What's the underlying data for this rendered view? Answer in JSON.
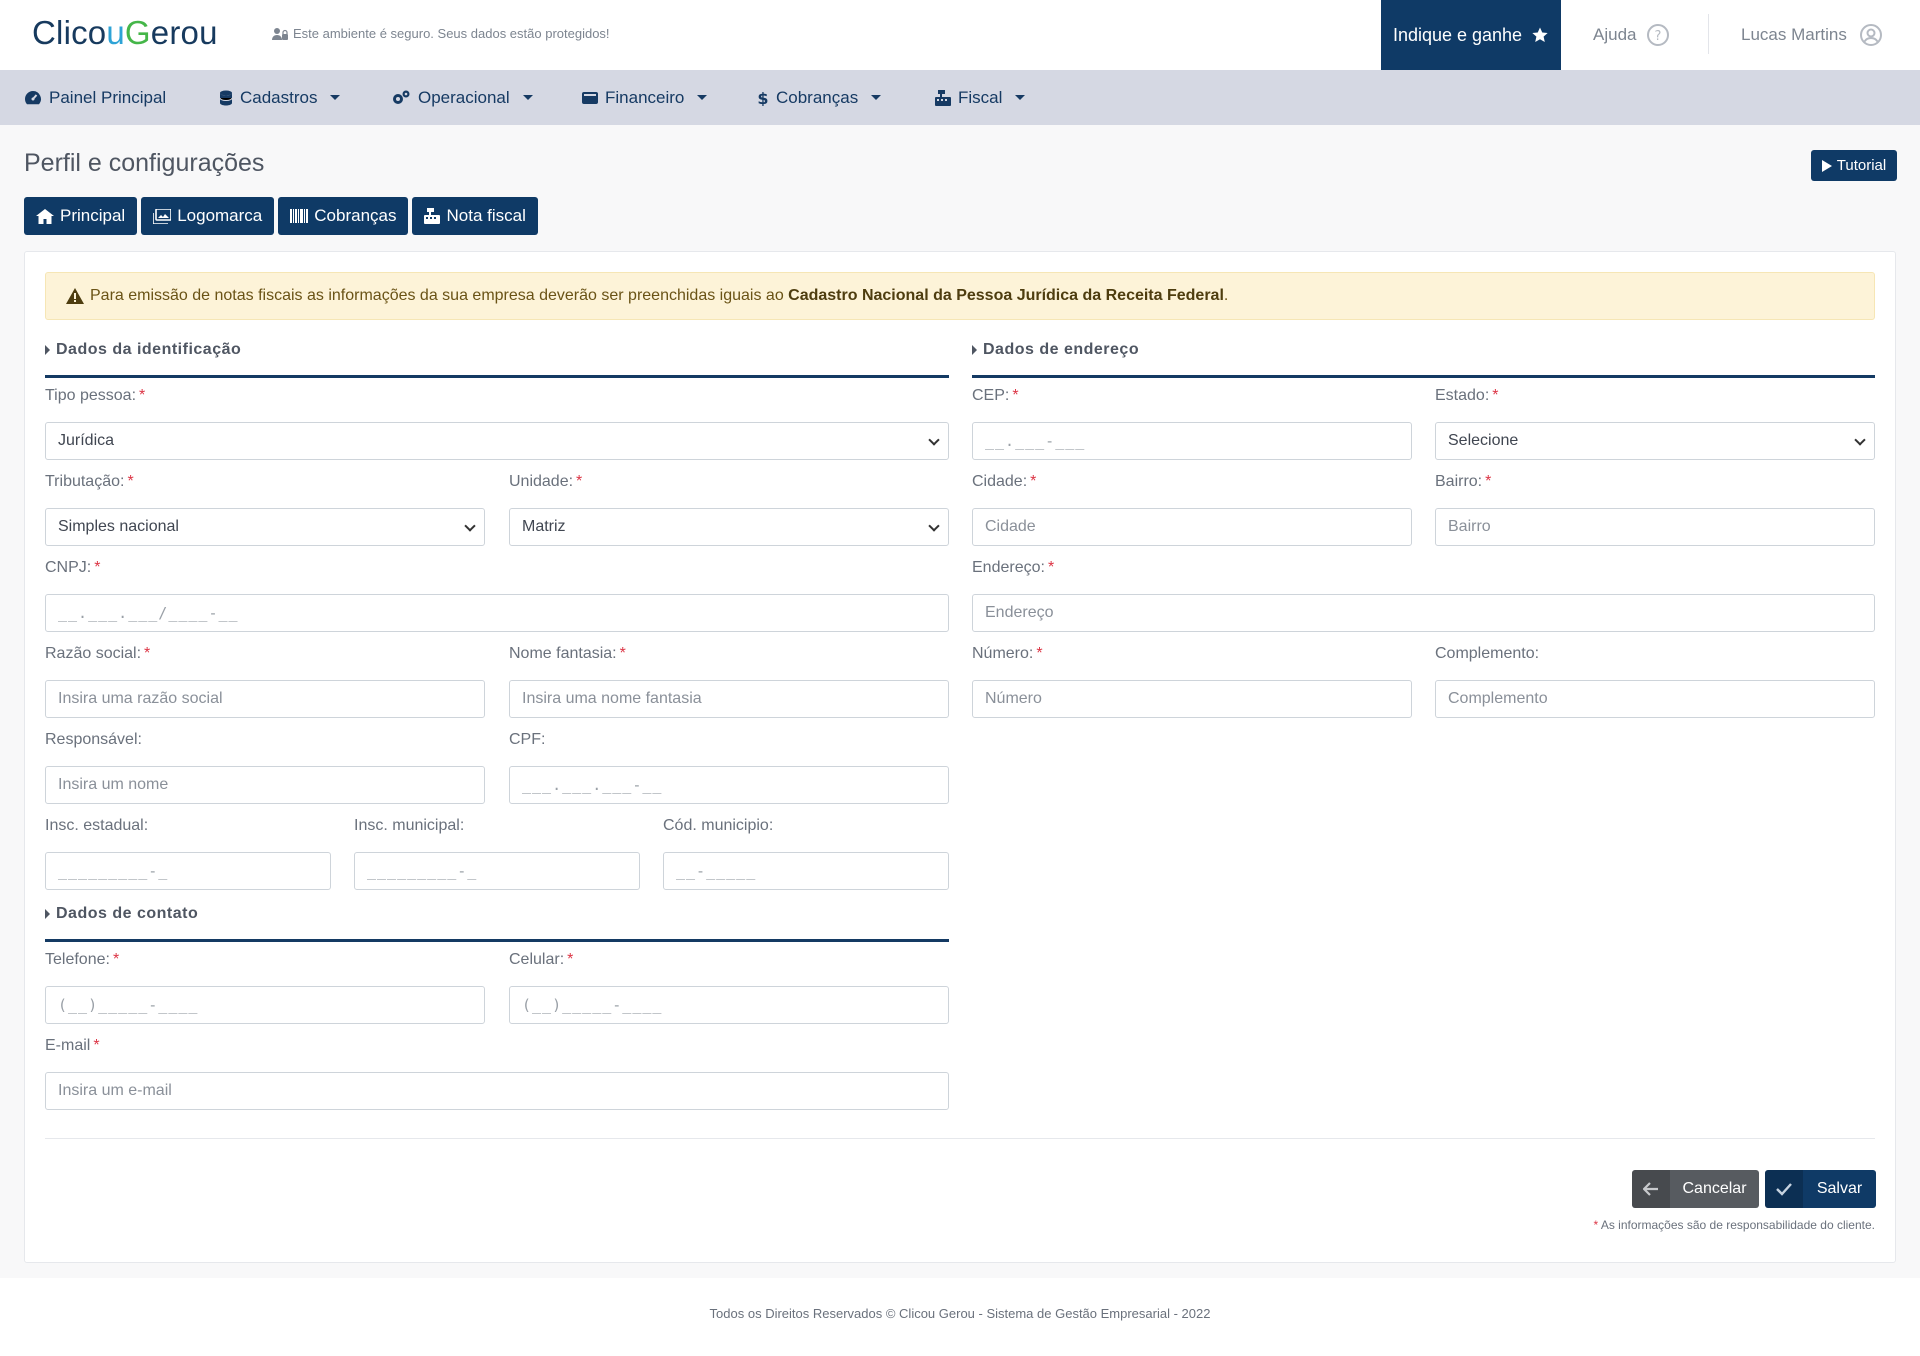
{
  "header": {
    "logo_left": "Clico",
    "logo_u": "u",
    "logo_g": "G",
    "logo_right": "erou",
    "secure_text": "Este ambiente é seguro. Seus dados estão protegidos!",
    "indique": "Indique e ganhe",
    "ajuda": "Ajuda",
    "user_name": "Lucas Martins"
  },
  "nav": {
    "items": [
      {
        "label": "Painel Principal",
        "icon": "dashboard-icon"
      },
      {
        "label": "Cadastros",
        "icon": "database-icon"
      },
      {
        "label": "Operacional",
        "icon": "cogs-icon"
      },
      {
        "label": "Financeiro",
        "icon": "wallet-icon"
      },
      {
        "label": "Cobranças",
        "icon": "dollar-icon"
      },
      {
        "label": "Fiscal",
        "icon": "cash-register-icon"
      }
    ]
  },
  "page": {
    "title": "Perfil e configurações",
    "tutorial": "Tutorial",
    "tabs": [
      "Principal",
      "Logomarca",
      "Cobranças",
      "Nota fiscal"
    ]
  },
  "alert": {
    "text": "Para emissão de notas fiscais as informações da sua empresa deverão ser preenchidas iguais ao ",
    "bold": "Cadastro Nacional da Pessoa Jurídica da Receita Federal",
    "end": "."
  },
  "sections": {
    "identificacao": "Dados da identificação",
    "endereco": "Dados de endereço",
    "contato": "Dados de contato"
  },
  "fields": {
    "tipo_pessoa": {
      "label": "Tipo pessoa:",
      "value": "Jurídica"
    },
    "tributacao": {
      "label": "Tributação:",
      "value": "Simples nacional"
    },
    "unidade": {
      "label": "Unidade:",
      "value": "Matriz"
    },
    "cnpj": {
      "label": "CNPJ:",
      "mask": "__.___.___/____-__"
    },
    "razao_social": {
      "label": "Razão social:",
      "placeholder": "Insira uma razão social"
    },
    "nome_fantasia": {
      "label": "Nome fantasia:",
      "placeholder": "Insira uma nome fantasia"
    },
    "responsavel": {
      "label": "Responsável:",
      "placeholder": "Insira um nome"
    },
    "cpf": {
      "label": "CPF:",
      "mask": "___.___.___-__"
    },
    "insc_estadual": {
      "label": "Insc. estadual:",
      "mask": "_________-_"
    },
    "insc_municipal": {
      "label": "Insc. municipal:",
      "mask": "_________-_"
    },
    "cod_municipio": {
      "label": "Cód. municipio:",
      "mask": "__-_____"
    },
    "telefone": {
      "label": "Telefone:",
      "mask": "(__)_____-____"
    },
    "celular": {
      "label": "Celular:",
      "mask": "(__)_____-____"
    },
    "email": {
      "label": "E-mail",
      "placeholder": "Insira um e-mail"
    },
    "cep": {
      "label": "CEP:",
      "mask": "__.___-___"
    },
    "estado": {
      "label": "Estado:",
      "value": "Selecione"
    },
    "cidade": {
      "label": "Cidade:",
      "placeholder": "Cidade"
    },
    "bairro": {
      "label": "Bairro:",
      "placeholder": "Bairro"
    },
    "endereco": {
      "label": "Endereço:",
      "placeholder": "Endereço"
    },
    "numero": {
      "label": "Número:",
      "placeholder": "Número"
    },
    "complemento": {
      "label": "Complemento:",
      "placeholder": "Complemento"
    }
  },
  "actions": {
    "cancel": "Cancelar",
    "save": "Salvar",
    "note_star": "*",
    "note": " As informações são de responsabilidade do cliente."
  },
  "footer": "Todos os Direitos Reservados © Clicou Gerou - Sistema de Gestão Empresarial - 2022",
  "colors": {
    "primary": "#0f3a66",
    "nav_bg": "#d5d8e3",
    "alert_bg": "#fdf3d8",
    "required": "#dc3545"
  }
}
